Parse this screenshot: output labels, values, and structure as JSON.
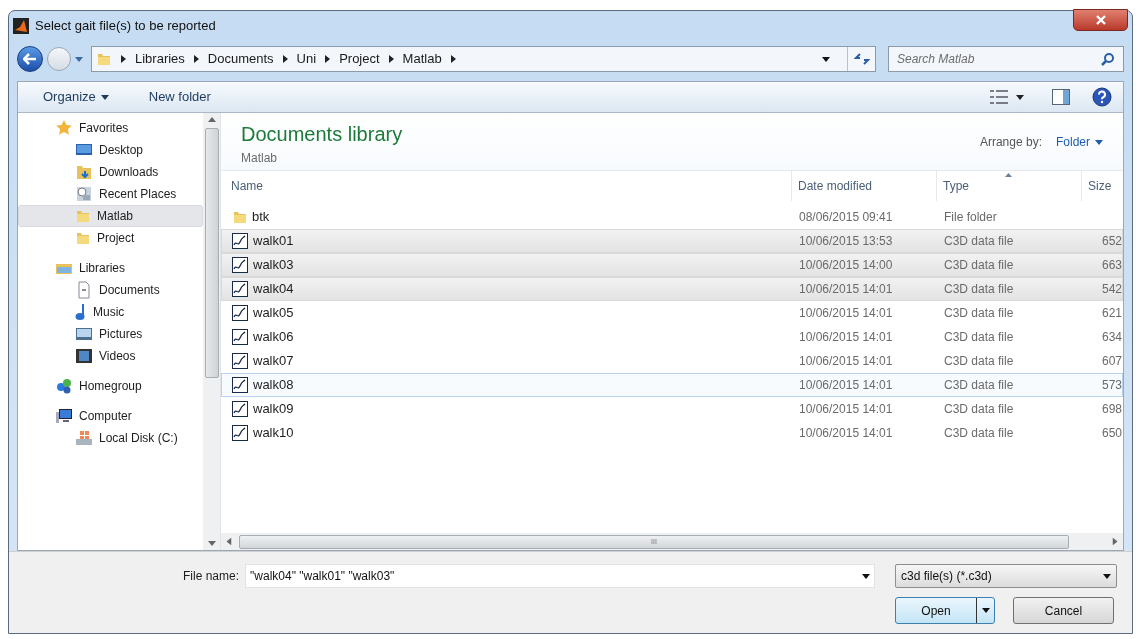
{
  "window": {
    "title": "Select gait file(s) to be reported"
  },
  "address_bar": {
    "crumbs": [
      "Libraries",
      "Documents",
      "Uni",
      "Project",
      "Matlab"
    ]
  },
  "search": {
    "placeholder": "Search Matlab"
  },
  "toolbar": {
    "organize": "Organize",
    "new_folder": "New folder"
  },
  "sidebar": {
    "items": [
      {
        "label": "Favorites",
        "kind": "star",
        "selected": false,
        "children": [
          {
            "label": "Desktop",
            "kind": "desktop",
            "selected": false
          },
          {
            "label": "Downloads",
            "kind": "downloads",
            "selected": false
          },
          {
            "label": "Recent Places",
            "kind": "recent",
            "selected": false
          },
          {
            "label": "Matlab",
            "kind": "folder",
            "selected": true
          },
          {
            "label": "Project",
            "kind": "folder",
            "selected": false
          }
        ]
      },
      {
        "label": "Libraries",
        "kind": "library",
        "selected": false,
        "children": [
          {
            "label": "Documents",
            "kind": "document",
            "selected": false
          },
          {
            "label": "Music",
            "kind": "music",
            "selected": false
          },
          {
            "label": "Pictures",
            "kind": "pictures",
            "selected": false
          },
          {
            "label": "Videos",
            "kind": "videos",
            "selected": false
          }
        ]
      },
      {
        "label": "Homegroup",
        "kind": "homegroup",
        "selected": false
      },
      {
        "label": "Computer",
        "kind": "computer",
        "selected": false,
        "children": [
          {
            "label": "Local Disk (C:)",
            "kind": "disk",
            "selected": false
          }
        ]
      }
    ]
  },
  "library": {
    "title": "Documents library",
    "subtitle": "Matlab",
    "arrange_label": "Arrange by:",
    "arrange_value": "Folder"
  },
  "table": {
    "columns": [
      "Name",
      "Date modified",
      "Type",
      "Size"
    ],
    "rows": [
      {
        "kind": "folder",
        "name": "btk",
        "date": "08/06/2015 09:41",
        "type": "File folder",
        "size": "",
        "selected": false,
        "focused": false
      },
      {
        "kind": "file",
        "name": "walk01",
        "date": "10/06/2015 13:53",
        "type": "C3D data file",
        "size": "652",
        "selected": true,
        "focused": false
      },
      {
        "kind": "file",
        "name": "walk03",
        "date": "10/06/2015 14:00",
        "type": "C3D data file",
        "size": "663",
        "selected": true,
        "focused": false
      },
      {
        "kind": "file",
        "name": "walk04",
        "date": "10/06/2015 14:01",
        "type": "C3D data file",
        "size": "542",
        "selected": true,
        "focused": false
      },
      {
        "kind": "file",
        "name": "walk05",
        "date": "10/06/2015 14:01",
        "type": "C3D data file",
        "size": "621",
        "selected": false,
        "focused": false
      },
      {
        "kind": "file",
        "name": "walk06",
        "date": "10/06/2015 14:01",
        "type": "C3D data file",
        "size": "634",
        "selected": false,
        "focused": false
      },
      {
        "kind": "file",
        "name": "walk07",
        "date": "10/06/2015 14:01",
        "type": "C3D data file",
        "size": "607",
        "selected": false,
        "focused": false
      },
      {
        "kind": "file",
        "name": "walk08",
        "date": "10/06/2015 14:01",
        "type": "C3D data file",
        "size": "573",
        "selected": false,
        "focused": true
      },
      {
        "kind": "file",
        "name": "walk09",
        "date": "10/06/2015 14:01",
        "type": "C3D data file",
        "size": "698",
        "selected": false,
        "focused": false
      },
      {
        "kind": "file",
        "name": "walk10",
        "date": "10/06/2015 14:01",
        "type": "C3D data file",
        "size": "650",
        "selected": false,
        "focused": false
      }
    ]
  },
  "horizontal_scroll": {
    "grip": "III"
  },
  "file_name": {
    "label": "File name:",
    "value": "\"walk04\" \"walk01\" \"walk03\""
  },
  "file_type": {
    "value": "c3d file(s) (*.c3d)"
  },
  "buttons": {
    "open": "Open",
    "cancel": "Cancel"
  }
}
